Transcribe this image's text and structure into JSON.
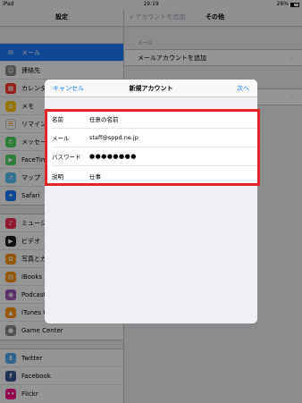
{
  "status_bar": {
    "device": "iPad",
    "time": "19:19",
    "battery": "26%"
  },
  "sidebar": {
    "title": "設定",
    "groups": [
      [
        {
          "label": "メール",
          "icon": "mail-icon",
          "color": "#1b7cff",
          "selected": true
        },
        {
          "label": "連絡先",
          "icon": "contacts-icon",
          "color": "#8e8e93"
        },
        {
          "label": "カレンダー",
          "icon": "calendar-icon",
          "color": "#ff3b30"
        },
        {
          "label": "メモ",
          "icon": "notes-icon",
          "color": "#ffcc00"
        },
        {
          "label": "リマインダー",
          "icon": "reminders-icon",
          "color": "#ffffff"
        },
        {
          "label": "メッセージ",
          "icon": "messages-icon",
          "color": "#4cd964"
        },
        {
          "label": "FaceTime",
          "icon": "facetime-icon",
          "color": "#4cd964"
        },
        {
          "label": "マップ",
          "icon": "maps-icon",
          "color": "#5ac8fa"
        },
        {
          "label": "Safari",
          "icon": "safari-icon",
          "color": "#1b7cff"
        }
      ],
      [
        {
          "label": "ミュージック",
          "icon": "music-icon",
          "color": "#ff2d55"
        },
        {
          "label": "ビデオ",
          "icon": "video-icon",
          "color": "#1c1c1e"
        },
        {
          "label": "写真とカメラ",
          "icon": "photos-icon",
          "color": "#ff9500"
        },
        {
          "label": "iBooks",
          "icon": "ibooks-icon",
          "color": "#ff9500"
        },
        {
          "label": "Podcast",
          "icon": "podcasts-icon",
          "color": "#9b59b6"
        },
        {
          "label": "iTunes U",
          "icon": "itunes-u-icon",
          "color": "#ff9500"
        },
        {
          "label": "Game Center",
          "icon": "game-center-icon",
          "color": "#8e8e93"
        }
      ],
      [
        {
          "label": "Twitter",
          "icon": "twitter-icon",
          "color": "#55acee"
        },
        {
          "label": "Facebook",
          "icon": "facebook-icon",
          "color": "#3b5998"
        },
        {
          "label": "Flickr",
          "icon": "flickr-icon",
          "color": "#ff0084"
        }
      ]
    ]
  },
  "detail": {
    "back_label": "アカウントを追加",
    "title": "その他",
    "section_label": "メール",
    "row_label": "メールアカウントを追加"
  },
  "sheet": {
    "cancel": "キャンセル",
    "title": "新規アカウント",
    "next": "次へ",
    "fields": [
      {
        "label": "名前",
        "value": "任意の名前"
      },
      {
        "label": "メール",
        "value": "staff@sppd.ne.jp"
      },
      {
        "label": "パスワード",
        "value": "●●●●●●●●",
        "password": true
      },
      {
        "label": "説明",
        "value": "仕事"
      }
    ]
  },
  "colors": {
    "accent": "#1b7cff",
    "highlight": "#e3242b"
  }
}
